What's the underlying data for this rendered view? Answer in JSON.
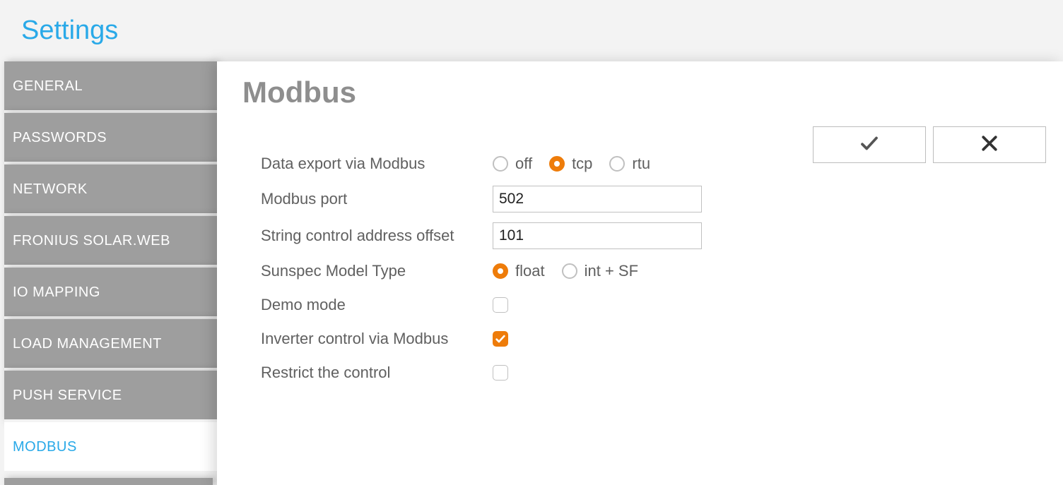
{
  "header": {
    "title": "Settings"
  },
  "sidebar": {
    "items": [
      {
        "label": "GENERAL",
        "active": false
      },
      {
        "label": "PASSWORDS",
        "active": false
      },
      {
        "label": "NETWORK",
        "active": false
      },
      {
        "label": "FRONIUS SOLAR.WEB",
        "active": false
      },
      {
        "label": "IO MAPPING",
        "active": false
      },
      {
        "label": "LOAD MANAGEMENT",
        "active": false
      },
      {
        "label": "PUSH SERVICE",
        "active": false
      },
      {
        "label": "MODBUS",
        "active": true
      }
    ]
  },
  "main": {
    "heading": "Modbus",
    "form": {
      "data_export": {
        "label": "Data export via Modbus",
        "options": [
          "off",
          "tcp",
          "rtu"
        ],
        "selected": "tcp"
      },
      "port": {
        "label": "Modbus port",
        "value": "502"
      },
      "offset": {
        "label": "String control address offset",
        "value": "101"
      },
      "sunspec": {
        "label": "Sunspec Model Type",
        "options": [
          "float",
          "int + SF"
        ],
        "selected": "float"
      },
      "demo": {
        "label": "Demo mode",
        "checked": false
      },
      "inverter_control": {
        "label": "Inverter control via Modbus",
        "checked": true
      },
      "restrict": {
        "label": "Restrict the control",
        "checked": false
      }
    }
  }
}
